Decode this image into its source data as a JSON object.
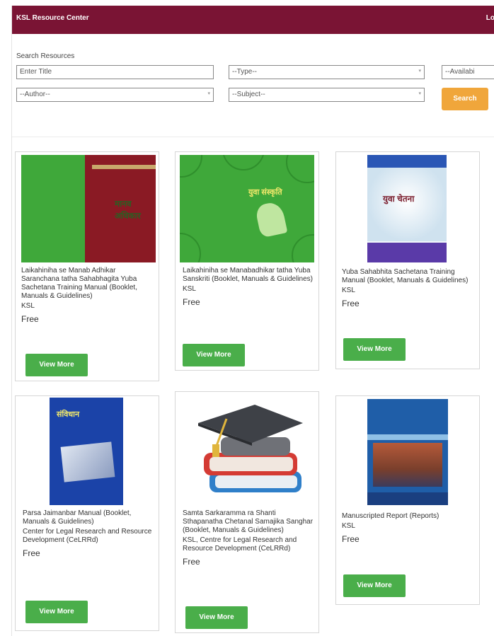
{
  "header": {
    "title": "KSL Resource Center",
    "login_label": "Lo"
  },
  "search": {
    "label": "Search Resources",
    "title_placeholder": "Enter Title",
    "type_select": "--Type--",
    "availability_select": "--Availabi",
    "author_select": "--Author--",
    "subject_select": "--Subject--",
    "search_button": "Search"
  },
  "colors": {
    "header_bg": "#7a1434",
    "search_button": "#f0a63b",
    "view_more_button": "#4aae4a"
  },
  "resources": [
    {
      "title": "Laikahiniha se Manab Adhikar Saranchana tatha Sahabhagita Yuba Sachetana Training Manual (Booklet, Manuals & Guidelines)",
      "publisher": "KSL",
      "price": "Free",
      "button": "View More",
      "cover_icon": "green-maroon-book-cover"
    },
    {
      "title": "Laikahiniha se Manabadhikar tatha Yuba Sanskriti (Booklet, Manuals & Guidelines)",
      "publisher": "KSL",
      "price": "Free",
      "button": "View More",
      "cover_icon": "green-hands-book-cover"
    },
    {
      "title": "Yuba Sahabhita Sachetana Training Manual (Booklet, Manuals & Guidelines)",
      "publisher": "KSL",
      "price": "Free",
      "button": "View More",
      "cover_icon": "blue-purple-book-cover"
    },
    {
      "title": "Parsa Jaimanbar Manual (Booklet, Manuals & Guidelines)",
      "publisher": "Center for Legal Research and Resource Development (CeLRRd)",
      "price": "Free",
      "button": "View More",
      "cover_icon": "blue-book-cover"
    },
    {
      "title": "Samta Sarkaramma ra Shanti Sthapanatha Chetanal Samajika Sanghar (Booklet, Manuals & Guidelines)",
      "publisher": "KSL, Centre for Legal Research and Resource Development (CeLRRd)",
      "price": "Free",
      "button": "View More",
      "cover_icon": "graduation-cap-books-icon"
    },
    {
      "title": "Manuscripted Report (Reports)",
      "publisher": "KSL",
      "price": "Free",
      "button": "View More",
      "cover_icon": "report-cover-photo"
    }
  ]
}
